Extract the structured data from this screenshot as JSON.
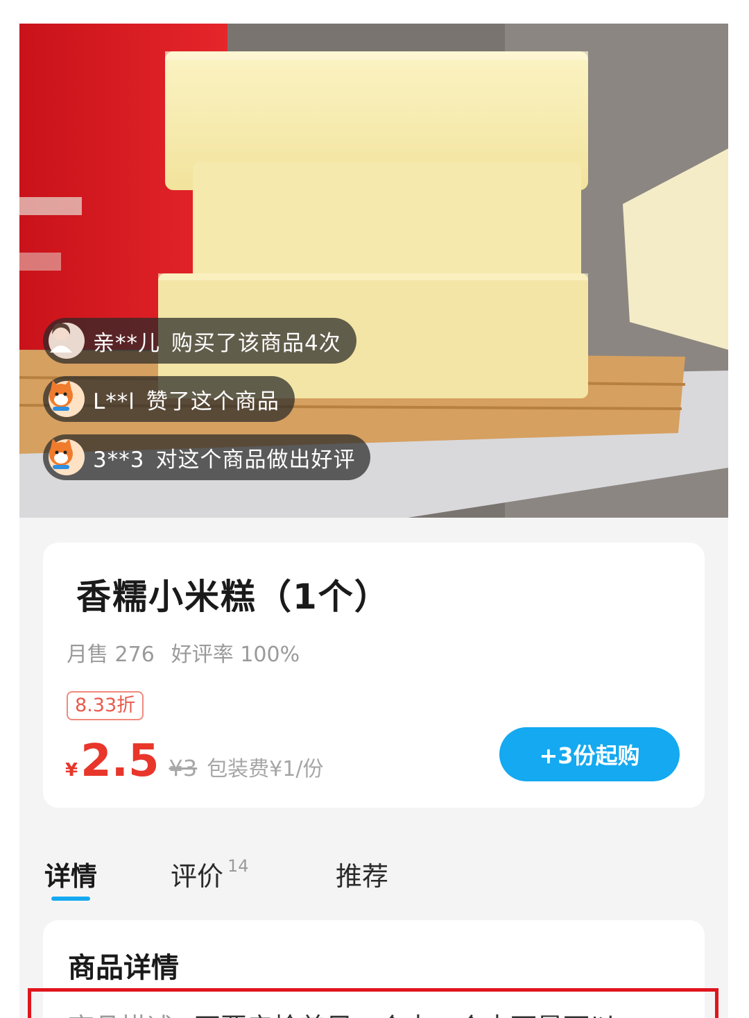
{
  "feed": [
    {
      "name": "亲**儿",
      "action": "购买了该商品4次",
      "avatar": "photo-avatar-icon"
    },
    {
      "name": "L**l",
      "action": "赞了这个商品",
      "avatar": "fox-avatar-icon"
    },
    {
      "name": "3**3",
      "action": "对这个商品做出好评",
      "avatar": "fox-avatar-icon"
    }
  ],
  "product": {
    "title": "香糯小米糕（1个）",
    "monthly_sales": "月售 276",
    "rating": "好评率 100%",
    "discount": "8.33折",
    "currency": "¥",
    "price": "2.5",
    "original_price": "¥3",
    "packaging": "包装费¥1/份",
    "buy_label": "+3份起购"
  },
  "tabs": [
    {
      "label": "详情",
      "active": true
    },
    {
      "label": "评价",
      "badge": "14"
    },
    {
      "label": "推荐"
    }
  ],
  "details": {
    "title": "商品详情",
    "desc_label": "商品描述",
    "desc_text": "不要亲检差足一个中一个中可是可以"
  },
  "colors": {
    "accent": "#14a9f0",
    "price": "#e8362b",
    "highlight_border": "#e0151d"
  }
}
